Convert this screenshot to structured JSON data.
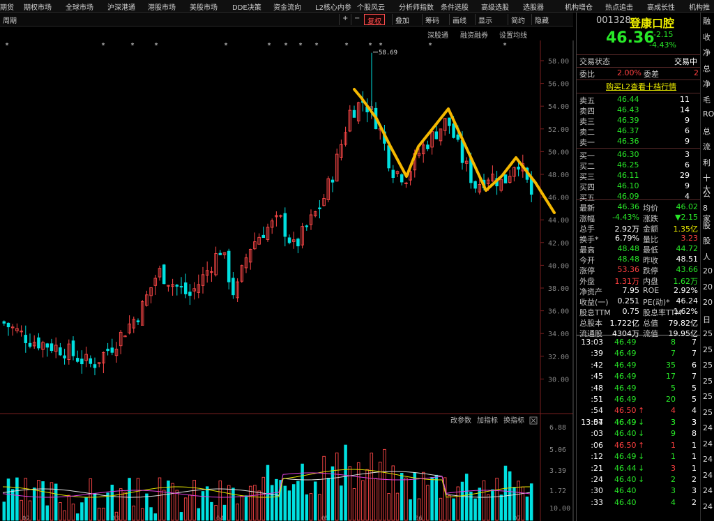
{
  "menu": [
    "期货",
    "期权市场",
    "全球市场",
    "沪深港通",
    "港股市场",
    "美股市场",
    "DDE决策",
    "资金流向",
    "L2核心内参",
    "个股风云",
    "分析师指数",
    "条件选股",
    "高级选股",
    "选股器",
    "机构增仓",
    "热点追击",
    "高成长性",
    "机构推"
  ],
  "toolbar": {
    "period": "周期",
    "plus": "+",
    "minus": "−",
    "restore": "复权",
    "overlay": "叠加",
    "chips": "筹码",
    "draw": "画线",
    "display": "显示",
    "simple": "简约",
    "hide": "隐藏"
  },
  "chart_links": {
    "deep_push": "深股通",
    "margin": "融资融券",
    "ma_settings": "设置均线"
  },
  "price_axis": [
    "58.00",
    "56.00",
    "54.00",
    "52.00",
    "50.00",
    "48.00",
    "46.00",
    "44.00",
    "42.00",
    "40.00",
    "38.00",
    "36.00",
    "34.00",
    "32.00",
    "30.00"
  ],
  "peak_label": "58.69",
  "volume_links": {
    "params": "改参数",
    "add": "加指标",
    "switch": "换指标"
  },
  "volume_axis": [
    "6.88",
    "5.06",
    "3.39",
    "1.72",
    "10.00"
  ],
  "date_axis": [
    "02",
    "03",
    "04",
    "05",
    "06",
    "07"
  ],
  "stock": {
    "code": "001328",
    "name": "登康口腔",
    "price": "46.36",
    "change": "-2.15",
    "change_pct": "-4.43%",
    "status_label": "交易状态",
    "status": "交易中",
    "wb_label": "委比",
    "wb": "2.00%",
    "wc_label": "委差",
    "wc": "2",
    "l2_button": "购买L2查看十档行情"
  },
  "asks": [
    {
      "label": "卖五",
      "price": "46.44",
      "vol": "11"
    },
    {
      "label": "卖四",
      "price": "46.43",
      "vol": "14"
    },
    {
      "label": "卖三",
      "price": "46.39",
      "vol": "9"
    },
    {
      "label": "卖二",
      "price": "46.37",
      "vol": "6"
    },
    {
      "label": "卖一",
      "price": "46.36",
      "vol": "9"
    }
  ],
  "bids": [
    {
      "label": "买一",
      "price": "46.30",
      "vol": "3"
    },
    {
      "label": "买二",
      "price": "46.25",
      "vol": "6"
    },
    {
      "label": "买三",
      "price": "46.11",
      "vol": "29"
    },
    {
      "label": "买四",
      "price": "46.10",
      "vol": "9"
    },
    {
      "label": "买五",
      "price": "46.09",
      "vol": "4"
    }
  ],
  "stats": [
    {
      "l1": "最新",
      "v1": "46.36",
      "c1": "green",
      "l2": "均价",
      "v2": "46.02",
      "c2": "green"
    },
    {
      "l1": "涨幅",
      "v1": "-4.43%",
      "c1": "green",
      "l2": "涨跌",
      "v2": "▼2.15",
      "c2": "green"
    },
    {
      "l1": "总手",
      "v1": "2.92万",
      "c1": "white",
      "l2": "金额",
      "v2": "1.35亿",
      "c2": "yellow"
    },
    {
      "l1": "换手*",
      "v1": "6.79%",
      "c1": "white",
      "l2": "量比",
      "v2": "3.23",
      "c2": "red"
    },
    {
      "l1": "最高",
      "v1": "48.48",
      "c1": "green",
      "l2": "最低",
      "v2": "44.72",
      "c2": "green"
    },
    {
      "l1": "今开",
      "v1": "48.48",
      "c1": "green",
      "l2": "昨收",
      "v2": "48.51",
      "c2": "white"
    },
    {
      "l1": "涨停",
      "v1": "53.36",
      "c1": "red",
      "l2": "跌停",
      "v2": "43.66",
      "c2": "green"
    },
    {
      "l1": "外盘",
      "v1": "1.31万",
      "c1": "red",
      "l2": "内盘",
      "v2": "1.62万",
      "c2": "green"
    },
    {
      "l1": "净资产",
      "v1": "7.95",
      "c1": "white",
      "l2": "ROE",
      "v2": "2.92%",
      "c2": "white"
    },
    {
      "l1": "收益(一)",
      "v1": "0.251",
      "c1": "white",
      "l2": "PE(动)*",
      "v2": "46.24",
      "c2": "white"
    },
    {
      "l1": "股息TTM",
      "v1": "0.75",
      "c1": "white",
      "l2": "股息率TTM",
      "v2": "1.62%",
      "c2": "white"
    },
    {
      "l1": "总股本",
      "v1": "1.722亿",
      "c1": "white",
      "l2": "总值",
      "v2": "79.82亿",
      "c2": "white"
    },
    {
      "l1": "流通股",
      "v1": "4304万",
      "c1": "white",
      "l2": "流值",
      "v2": "19.95亿",
      "c2": "white"
    }
  ],
  "ticks_a": [
    {
      "t": "13:03",
      "p": "46.49",
      "pc": "green",
      "v": "8",
      "n": "7",
      "vc": "green",
      "arr": ""
    },
    {
      "t": ":39",
      "p": "46.49",
      "pc": "green",
      "v": "7",
      "n": "7",
      "vc": "green",
      "arr": ""
    },
    {
      "t": ":42",
      "p": "46.49",
      "pc": "green",
      "v": "35",
      "n": "6",
      "vc": "green",
      "arr": ""
    },
    {
      "t": ":45",
      "p": "46.49",
      "pc": "green",
      "v": "17",
      "n": "7",
      "vc": "green",
      "arr": ""
    },
    {
      "t": ":48",
      "p": "46.49",
      "pc": "green",
      "v": "5",
      "n": "5",
      "vc": "green",
      "arr": ""
    },
    {
      "t": ":51",
      "p": "46.49",
      "pc": "green",
      "v": "20",
      "n": "5",
      "vc": "green",
      "arr": ""
    },
    {
      "t": ":54",
      "p": "46.50",
      "pc": "red",
      "v": "4",
      "n": "4",
      "vc": "red",
      "arr": "↑"
    },
    {
      "t": ":57",
      "p": "46.49",
      "pc": "green",
      "v": "3",
      "n": "3",
      "vc": "green",
      "arr": "↓"
    }
  ],
  "ticks_b": [
    {
      "t": "13:04",
      "p": "46.49",
      "pc": "green",
      "v": "3",
      "n": "3",
      "vc": "green",
      "arr": ""
    },
    {
      "t": ":03",
      "p": "46.40",
      "pc": "green",
      "v": "9",
      "n": "8",
      "vc": "green",
      "arr": "↓"
    },
    {
      "t": ":06",
      "p": "46.50",
      "pc": "red",
      "v": "1",
      "n": "1",
      "vc": "red",
      "arr": "↑"
    },
    {
      "t": ":12",
      "p": "46.49",
      "pc": "green",
      "v": "1",
      "n": "1",
      "vc": "green",
      "arr": "↓"
    },
    {
      "t": ":21",
      "p": "46.44",
      "pc": "green",
      "v": "3",
      "n": "1",
      "vc": "red",
      "arr": "↓"
    },
    {
      "t": ":24",
      "p": "46.40",
      "pc": "green",
      "v": "2",
      "n": "2",
      "vc": "green",
      "arr": "↓"
    },
    {
      "t": ":30",
      "p": "46.40",
      "pc": "green",
      "v": "3",
      "n": "3",
      "vc": "green",
      "arr": ""
    },
    {
      "t": ":33",
      "p": "46.40",
      "pc": "green",
      "v": "4",
      "n": "2",
      "vc": "green",
      "arr": ""
    }
  ],
  "edge_text": [
    "融",
    "收",
    "净",
    "总",
    "净",
    "毛",
    "ROE",
    "总",
    "流",
    "利",
    "十大",
    "公",
    "8家",
    "股",
    "股",
    "人",
    "20",
    "20",
    "20",
    "日",
    "25",
    "25",
    "25",
    "25",
    "25",
    "25",
    "24",
    "24",
    "24",
    "24",
    "24",
    "24"
  ]
}
